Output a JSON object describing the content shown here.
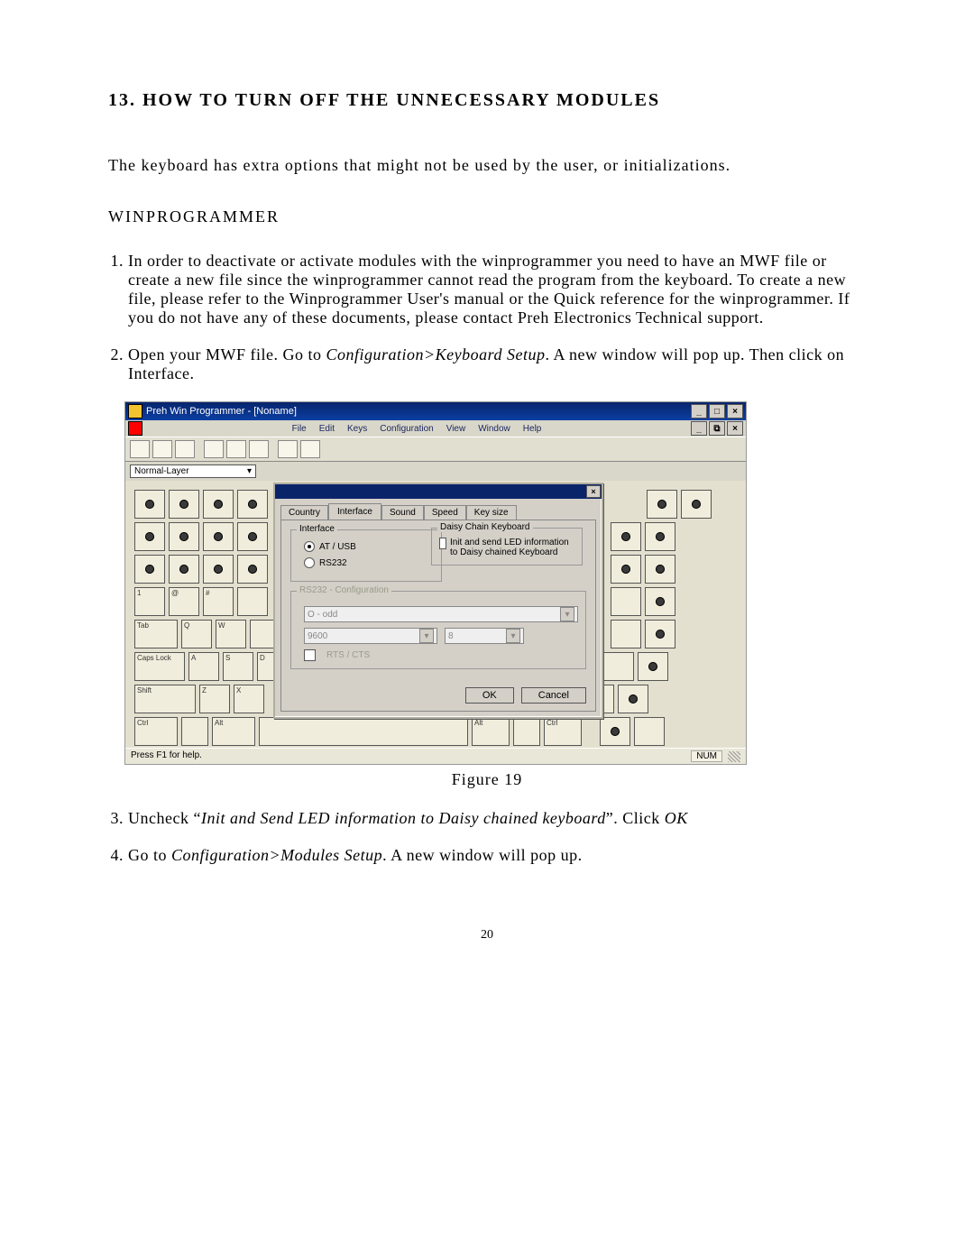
{
  "heading": "13. HOW TO TURN OFF THE UNNECESSARY MODULES",
  "intro": "The keyboard has extra options that might not be used by the user, or initializations.",
  "subheading": "WINPROGRAMMER",
  "steps": {
    "1": "In order to deactivate or activate modules with the winprogrammer you need to have an MWF file or create a new file since the winprogrammer cannot read the program from the keyboard. To create a new file, please refer to the Winprogrammer User's manual or the Quick reference for the winprogrammer. If you do not have any of these documents, please contact Preh Electronics Technical support.",
    "2_a": "Open your MWF file. Go to ",
    "2_em": "Configuration>Keyboard Setup",
    "2_b": ". A new window will pop up. Then click on Interface.",
    "3_a": "Uncheck “",
    "3_em": "Init and Send LED information to Daisy chained keyboard",
    "3_b": "”. Click ",
    "3_em2": "OK",
    "4_a": "Go to ",
    "4_em": "Configuration>Modules Setup",
    "4_b": ". A new window will pop up."
  },
  "figure_caption": "Figure 19",
  "page_number": "20",
  "screenshot": {
    "app_title": "Preh Win Programmer - [Noname]",
    "window_controls": {
      "minimize": "_",
      "maximize": "□",
      "close": "×"
    },
    "mdi_controls": {
      "minimize": "_",
      "restore": "⧉",
      "close": "×"
    },
    "menubar": [
      "File",
      "Edit",
      "Keys",
      "Configuration",
      "View",
      "Window",
      "Help"
    ],
    "layer_selector": "Normal-Layer",
    "status_left": "Press F1 for help.",
    "status_right": "NUM",
    "key_labels": {
      "tab": "Tab",
      "caps": "Caps Lock",
      "shift": "Shift",
      "ctrl": "Ctrl",
      "alt": "Alt",
      "q": "Q",
      "a": "A",
      "z": "Z",
      "w": "W",
      "s": "S",
      "x": "X",
      "d": "D"
    },
    "dialog": {
      "tabs": [
        "Country",
        "Interface",
        "Sound",
        "Speed",
        "Key size"
      ],
      "active_tab": "Interface",
      "group_interface": "Interface",
      "radio_atusb": "AT / USB",
      "radio_rs232": "RS232",
      "group_daisy": "Daisy Chain Keyboard",
      "daisy_check_label": "Init and send LED information to Daisy chained Keyboard",
      "group_rs232": "RS232 - Configuration",
      "rs232_parity": "O - odd",
      "rs232_baud": "9600",
      "rs232_bits": "8",
      "rs232_rts": "RTS / CTS",
      "btn_ok": "OK",
      "btn_cancel": "Cancel"
    }
  }
}
